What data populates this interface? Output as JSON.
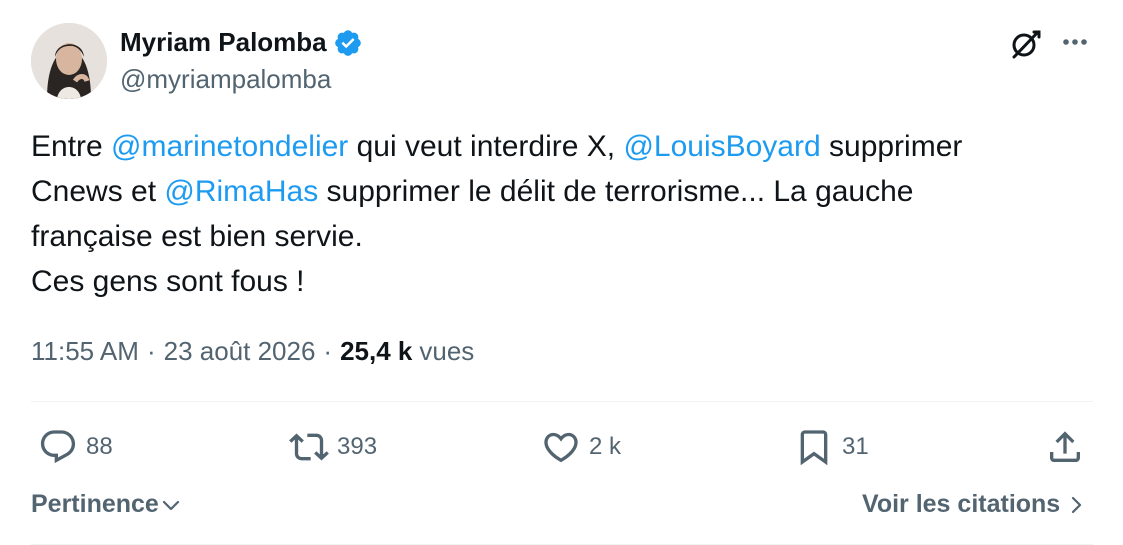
{
  "author": {
    "name": "Myriam Palomba",
    "handle": "@myriampalomba",
    "verified_color": "#1d9bf0",
    "avatar_icon": "profile-photo"
  },
  "header_icons": {
    "grok": "grok-icon",
    "more": "more-icon"
  },
  "tweet": {
    "line1_prefix": "Entre ",
    "mention1": "@marinetondelier",
    "line1_mid": " qui veut interdire X, ",
    "mention2": "@LouisBoyard",
    "line1_suffix": " supprimer",
    "line2_prefix": "Cnews et ",
    "mention3": "@RimaHas",
    "line2_suffix": " supprimer le délit de terrorisme... La gauche",
    "line3": "française est bien servie.",
    "line4": "Ces gens sont fous !"
  },
  "meta": {
    "time": "11:55 AM",
    "date": "23 août 2026",
    "views_count": "25,4 k",
    "views_label": "vues",
    "separator": "·"
  },
  "actions": {
    "replies": "88",
    "reposts": "393",
    "likes": "2 k",
    "bookmarks": "31"
  },
  "bottom": {
    "sort_label": "Pertinence",
    "quotes_label": "Voir les citations"
  },
  "colors": {
    "text": "#0f1419",
    "secondary": "#536471",
    "accent": "#1d9bf0",
    "divider": "#eff3f4"
  }
}
